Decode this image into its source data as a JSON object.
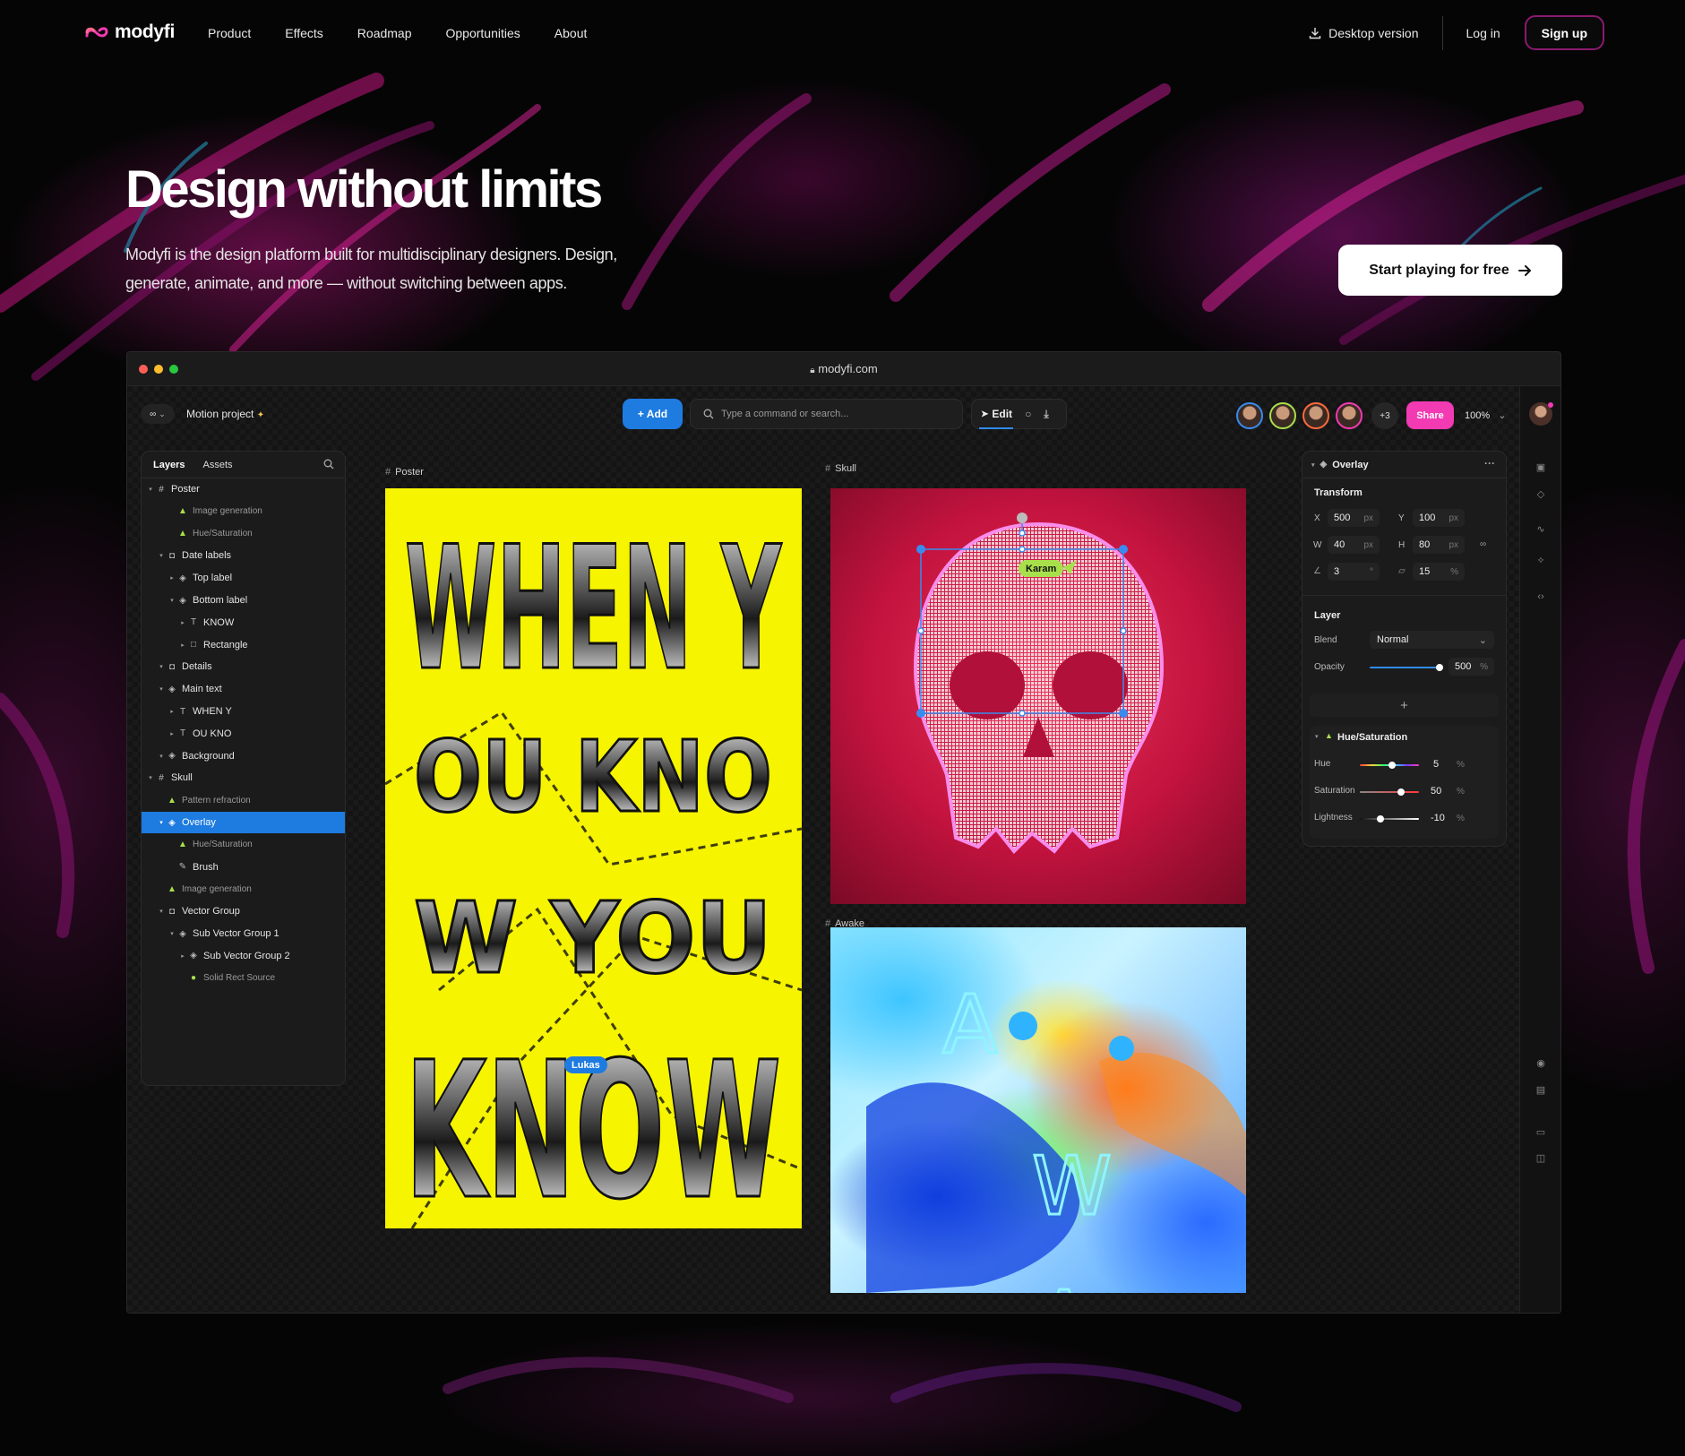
{
  "nav": {
    "brand": "modyfi",
    "links": [
      "Product",
      "Effects",
      "Roadmap",
      "Opportunities",
      "About"
    ],
    "desktop_label": "Desktop version",
    "login_label": "Log in",
    "signup_label": "Sign up"
  },
  "hero": {
    "title": "Design without limits",
    "subtitle": "Modyfi is the design platform built for multidisciplinary designers. Design, generate, animate, and more — without switching between apps.",
    "cta_label": "Start playing for free"
  },
  "window": {
    "url": "modyfi.com",
    "dots": [
      "#ff5f57",
      "#febc2e",
      "#28c840"
    ]
  },
  "toolbar": {
    "project_name": "Motion project",
    "add_label": "+ Add",
    "search_placeholder": "Type a command or search...",
    "edit_label": "Edit",
    "extra_users": "+3",
    "share_label": "Share",
    "zoom": "100%",
    "avatar_rings": [
      "#3a8bf0",
      "#a8e04b",
      "#ff6a3c",
      "#f23ab2"
    ]
  },
  "layers_panel": {
    "tabs": [
      "Layers",
      "Assets"
    ],
    "items": [
      {
        "label": "Poster",
        "icon": "#",
        "depth": 0,
        "caret": "▾",
        "muted": false
      },
      {
        "label": "Image generation",
        "icon": "▲",
        "depth": 2,
        "caret": "",
        "muted": true,
        "lime": true
      },
      {
        "label": "Hue/Saturation",
        "icon": "▲",
        "depth": 2,
        "caret": "",
        "muted": true,
        "lime": true
      },
      {
        "label": "Date labels",
        "icon": "◘",
        "depth": 1,
        "caret": "▾",
        "muted": false
      },
      {
        "label": "Top label",
        "icon": "◈",
        "depth": 2,
        "caret": "▸",
        "muted": false
      },
      {
        "label": "Bottom label",
        "icon": "◈",
        "depth": 2,
        "caret": "▾",
        "muted": false
      },
      {
        "label": "KNOW",
        "icon": "T",
        "depth": 3,
        "caret": "▸",
        "muted": false
      },
      {
        "label": "Rectangle",
        "icon": "□",
        "depth": 3,
        "caret": "▸",
        "muted": false
      },
      {
        "label": "Details",
        "icon": "◘",
        "depth": 1,
        "caret": "▾",
        "muted": false
      },
      {
        "label": "Main text",
        "icon": "◈",
        "depth": 1,
        "caret": "▾",
        "muted": false
      },
      {
        "label": "WHEN Y",
        "icon": "T",
        "depth": 2,
        "caret": "▸",
        "muted": false
      },
      {
        "label": "OU KNO",
        "icon": "T",
        "depth": 2,
        "caret": "▸",
        "muted": false
      },
      {
        "label": "Background",
        "icon": "◈",
        "depth": 1,
        "caret": "▾",
        "muted": false
      },
      {
        "label": "Skull",
        "icon": "#",
        "depth": 0,
        "caret": "▾",
        "muted": false
      },
      {
        "label": "Pattern refraction",
        "icon": "▲",
        "depth": 1,
        "caret": "",
        "muted": true,
        "lime": true
      },
      {
        "label": "Overlay",
        "icon": "◈",
        "depth": 1,
        "caret": "▾",
        "muted": false,
        "selected": true
      },
      {
        "label": "Hue/Saturation",
        "icon": "▲",
        "depth": 2,
        "caret": "",
        "muted": true,
        "lime": true
      },
      {
        "label": "Brush",
        "icon": "✎",
        "depth": 2,
        "caret": "",
        "muted": false
      },
      {
        "label": "Image generation",
        "icon": "▲",
        "depth": 1,
        "caret": "",
        "muted": true,
        "lime": true
      },
      {
        "label": "Vector Group",
        "icon": "◘",
        "depth": 1,
        "caret": "▾",
        "muted": false
      },
      {
        "label": "Sub Vector Group 1",
        "icon": "◈",
        "depth": 2,
        "caret": "▾",
        "muted": false
      },
      {
        "label": "Sub Vector Group 2",
        "icon": "◈",
        "depth": 3,
        "caret": "▸",
        "muted": false
      },
      {
        "label": "Solid Rect Source",
        "icon": "●",
        "depth": 3,
        "caret": "",
        "muted": true,
        "lime": true
      }
    ]
  },
  "artboards": {
    "poster_label": "Poster",
    "skull_label": "Skull",
    "awake_label": "Awake",
    "poster_lines": [
      "WHEN Y",
      "OU KNO",
      "W YOU",
      "KNOW"
    ],
    "awake_letters": [
      "A",
      "W",
      "A"
    ],
    "cursor_karam": "Karam",
    "cursor_lukas": "Lukas",
    "cursor_karam_color": "#a8e04b",
    "cursor_lukas_color": "#1e7be0"
  },
  "properties": {
    "header": "Overlay",
    "transform_title": "Transform",
    "x_label": "X",
    "x_value": "500",
    "x_unit": "px",
    "y_label": "Y",
    "y_value": "100",
    "y_unit": "px",
    "w_label": "W",
    "w_value": "40",
    "w_unit": "px",
    "h_label": "H",
    "h_value": "80",
    "h_unit": "px",
    "angle_value": "3",
    "angle_unit": "°",
    "skew_value": "15",
    "skew_unit": "%",
    "layer_title": "Layer",
    "blend_label": "Blend",
    "blend_value": "Normal",
    "opacity_label": "Opacity",
    "opacity_value": "500",
    "opacity_unit": "%",
    "opacity_level": 1.0,
    "hue_sat_title": "Hue/Saturation",
    "hue_label": "Hue",
    "hue_value": "5",
    "hue_unit": "%",
    "hue_level": 0.55,
    "sat_label": "Saturation",
    "sat_value": "50",
    "sat_unit": "%",
    "sat_level": 0.7,
    "light_label": "Lightness",
    "light_value": "-10",
    "light_unit": "%",
    "light_level": 0.35
  }
}
